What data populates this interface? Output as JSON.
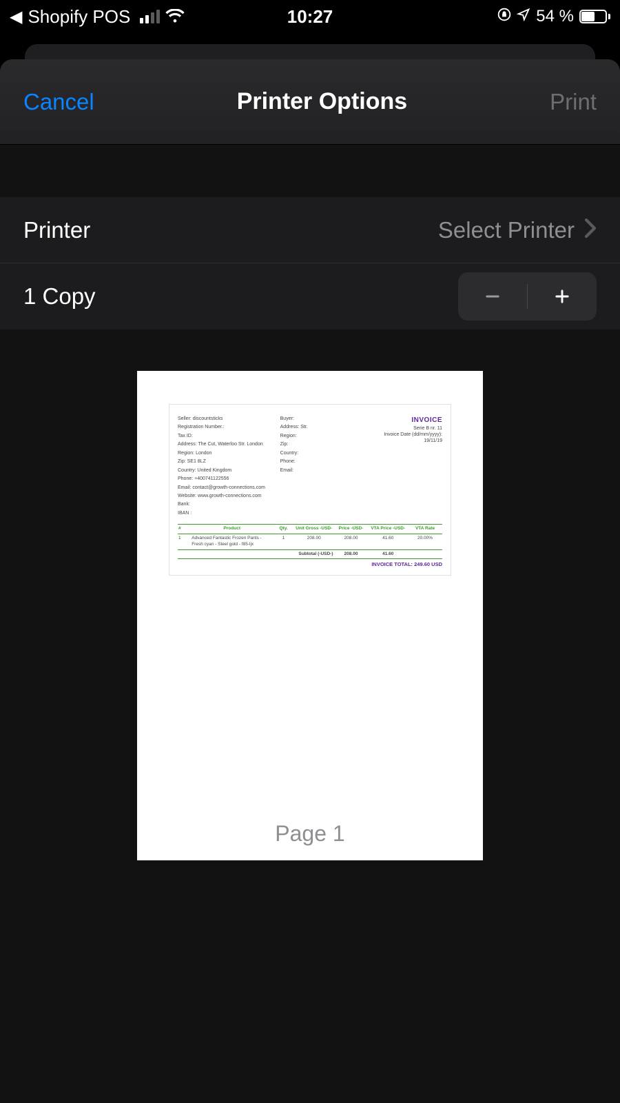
{
  "status_bar": {
    "back_app": "Shopify POS",
    "time": "10:27",
    "battery_text": "54 %"
  },
  "sheet": {
    "cancel": "Cancel",
    "title": "Printer Options",
    "print": "Print"
  },
  "rows": {
    "printer_label": "Printer",
    "printer_value": "Select Printer",
    "copies_label": "1 Copy"
  },
  "preview": {
    "page_caption": "Page 1"
  },
  "invoice": {
    "title": "INVOICE",
    "meta": {
      "serie": "Serie B nr. 11",
      "date_label": "Invoice Date (dd/mm/yyyy):",
      "date": "19/11/19"
    },
    "seller": {
      "l1": "Seller: discountsticks",
      "l2": "Registration Number.:",
      "l3": "Tax ID:",
      "l4": "Address: The Cut, Waterloo Str. London",
      "l5": "Region: London",
      "l6": "Zip: SE1 8LZ",
      "l7": "Country: United Kingdom",
      "l8": "Phone: +400741122556",
      "l9": "Email: contact@growth-connections.com",
      "l10": "Website: www.growth-connections.com",
      "l11": "Bank:",
      "l12": "IBAN :"
    },
    "buyer": {
      "l1": "Buyer:",
      "l2": "Address: Str.",
      "l3": "Region:",
      "l4": "Zip:",
      "l5": "Country:",
      "l6": "Phone:",
      "l7": "Email:"
    },
    "table": {
      "headers": {
        "num": "#",
        "product": "Product",
        "qty": "Qty.",
        "unit_gross": "Unit Gross -USD-",
        "price": "Price -USD-",
        "vta_price": "VTA Price -USD-",
        "vta_rate": "VTA Rate"
      },
      "row1": {
        "num": "1",
        "product": "Advanced Fantastic Frozen Pants - Fresh cyan - Steel gold - f85-ljx",
        "qty": "1",
        "unit_gross": "208.00",
        "price": "208.00",
        "vta_price": "41.60",
        "vta_rate": "20.00%"
      },
      "subtotal": {
        "label": "Subtotal (-USD-)",
        "price": "208.00",
        "vta_price": "41.60"
      },
      "total": "INVOICE TOTAL: 249.60 USD"
    }
  }
}
